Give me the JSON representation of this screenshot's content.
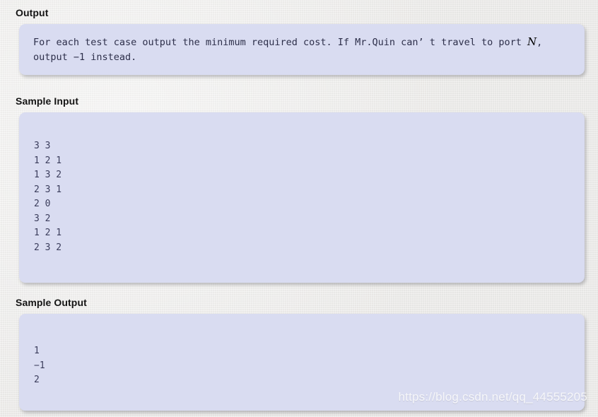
{
  "page": {
    "background_color": "#ebeae8",
    "panel_color": "#d9dcf1",
    "heading_color": "#141414",
    "mono_text_color": "#2d2f4a"
  },
  "sections": {
    "output": {
      "title": "Output",
      "paragraph_part1": "For each test case output the minimum required cost. If Mr.Quin can’ t travel to port ",
      "math_variable": "N",
      "paragraph_part2": ", output −1 instead."
    },
    "sample_input": {
      "title": "Sample Input",
      "lines": [
        "3 3",
        "1 2 1",
        "1 3 2",
        "2 3 1",
        "2 0",
        "3 2",
        "1 2 1",
        "2 3 2"
      ]
    },
    "sample_output": {
      "title": "Sample Output",
      "lines": [
        "1",
        "−1",
        "2"
      ]
    }
  },
  "watermark": {
    "text": "https://blog.csdn.net/qq_44555205"
  }
}
